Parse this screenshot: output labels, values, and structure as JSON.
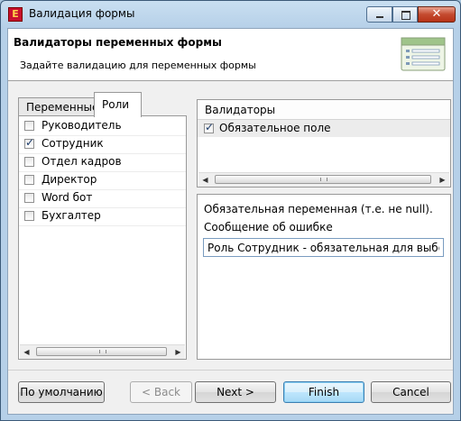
{
  "window": {
    "title": "Валидация формы",
    "app_icon_letter": "E"
  },
  "header": {
    "title": "Валидаторы переменных формы",
    "description": "Задайте валидацию для переменных формы"
  },
  "tabs": [
    {
      "label": "Переменные",
      "active": false
    },
    {
      "label": "Роли",
      "active": true
    }
  ],
  "roles": [
    {
      "label": "Руководитель",
      "checked": false
    },
    {
      "label": "Сотрудник",
      "checked": true
    },
    {
      "label": "Отдел кадров",
      "checked": false
    },
    {
      "label": "Директор",
      "checked": false
    },
    {
      "label": "Word бот",
      "checked": false
    },
    {
      "label": "Бухгалтер",
      "checked": false
    }
  ],
  "validators": {
    "header": "Валидаторы",
    "items": [
      {
        "label": "Обязательное поле",
        "checked": true
      }
    ]
  },
  "details": {
    "description": "Обязательная переменная (т.е. не null).",
    "error_label": "Сообщение об ошибке",
    "error_value": "Роль Сотрудник - обязательная для выбора"
  },
  "buttons": {
    "defaults": "По умолчанию",
    "back": "< Back",
    "next": "Next >",
    "finish": "Finish",
    "cancel": "Cancel"
  },
  "colors": {
    "accent": "#3c7fb1",
    "titlebar": "#b6d0e8",
    "close": "#c44a2f"
  }
}
